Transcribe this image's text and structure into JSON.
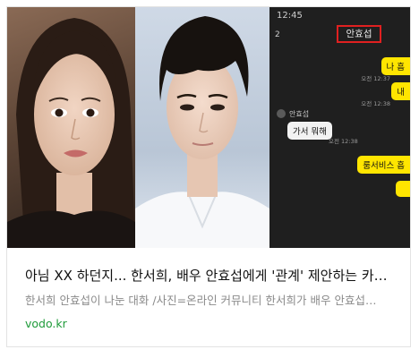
{
  "article": {
    "title": "아님 XX 하던지... 한서희, 배우 안효섭에게 '관계' 제안하는 카…",
    "description": "한서희 안효섭이 나눈 대화 /사진=온라인 커뮤니티 한서희가 배우 안효섭…",
    "source": "vodo.kr"
  },
  "chat": {
    "time": "12:45",
    "count": "2",
    "name": "안효섭",
    "sender": "안효섭",
    "messages": [
      {
        "text": "나 흠",
        "time": "오전 12:37"
      },
      {
        "text": "내",
        "time": "오전 12:38"
      },
      {
        "text": "가서 뭐해",
        "time": "오전 12:38"
      },
      {
        "text": "룸서비스 흠",
        "time": ""
      },
      {
        "text": "",
        "time": ""
      }
    ]
  }
}
